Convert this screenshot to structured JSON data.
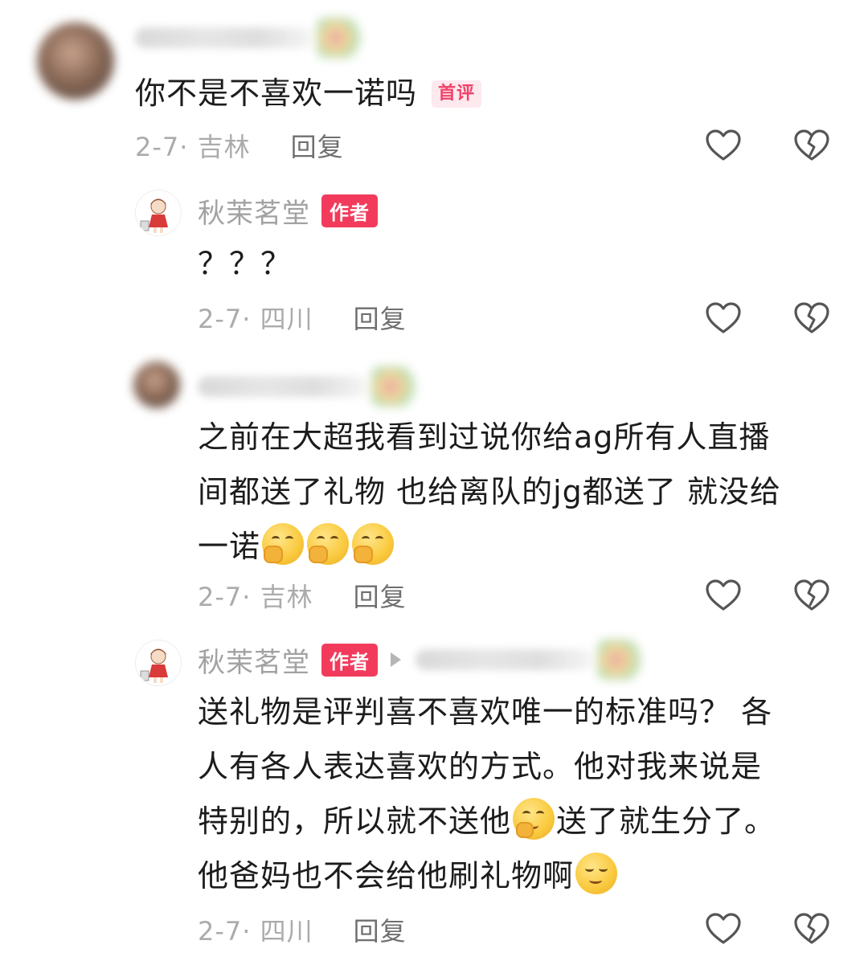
{
  "comments": [
    {
      "text": "你不是不喜欢一诺吗",
      "first_badge": "首评",
      "date": "2-7",
      "location": "吉林",
      "reply_label": "回复"
    },
    {
      "username": "秋茉茗堂",
      "author_badge": "作者",
      "text": "？？？",
      "date": "2-7",
      "location": "四川",
      "reply_label": "回复"
    },
    {
      "text_lines": [
        "之前在大超我看到过说你给ag所有人直播",
        "间都送了礼物 也给离队的jg都送了 就没给",
        "一诺"
      ],
      "emojis": [
        "covering-mouth-emoji",
        "covering-mouth-emoji",
        "covering-mouth-emoji"
      ],
      "date": "2-7",
      "location": "吉林",
      "reply_label": "回复"
    },
    {
      "username": "秋茉茗堂",
      "author_badge": "作者",
      "text_lines": [
        "送礼物是评判喜不喜欢唯一的标准吗？ 各",
        "人有各人表达喜欢的方式。他对我来说是",
        "特别的，所以就不送他",
        "送了就生分了。",
        "他爸妈也不会给他刷礼物啊"
      ],
      "emojis": [
        "thinking-emoji",
        "smug-emoji"
      ],
      "date": "2-7",
      "location": "四川",
      "reply_label": "回复"
    }
  ],
  "colors": {
    "author_badge": "#f23b5c",
    "first_badge_text": "#f0436a",
    "first_badge_bg": "#fde9ee",
    "meta_text": "#ababab",
    "username": "#a2a2a2"
  }
}
